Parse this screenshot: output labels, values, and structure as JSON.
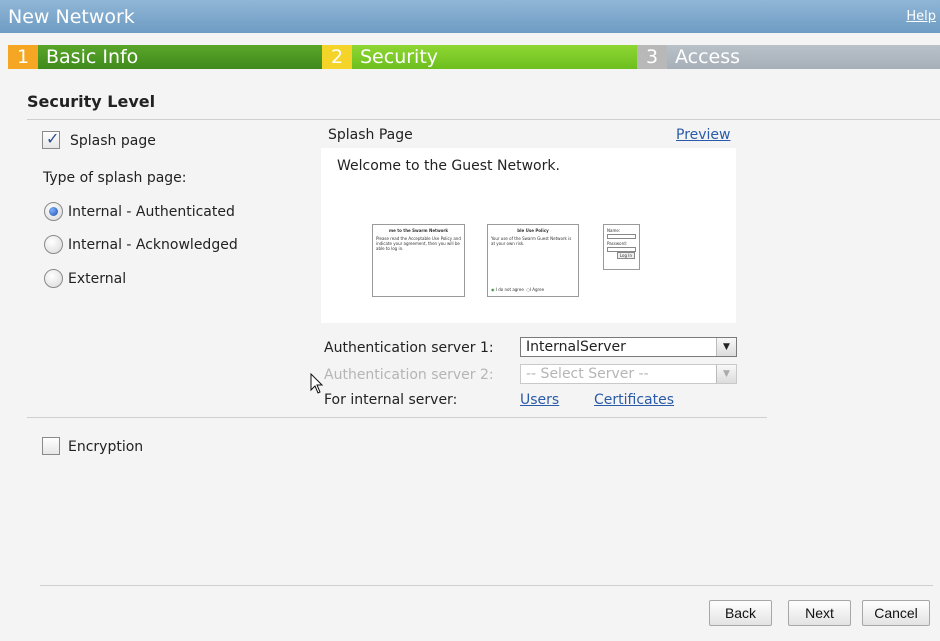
{
  "window": {
    "title": "New Network",
    "help_label": "Help"
  },
  "steps": [
    {
      "num": "1",
      "label": "Basic Info"
    },
    {
      "num": "2",
      "label": "Security"
    },
    {
      "num": "3",
      "label": "Access"
    }
  ],
  "section_title": "Security Level",
  "splash": {
    "checkbox_label": "Splash page",
    "checked": true,
    "type_label": "Type of splash page:",
    "options": [
      {
        "label": "Internal - Authenticated",
        "selected": true
      },
      {
        "label": "Internal - Acknowledged",
        "selected": false
      },
      {
        "label": "External",
        "selected": false
      }
    ]
  },
  "preview": {
    "header": "Splash Page",
    "link": "Preview",
    "welcome": "Welcome to the Guest Network.",
    "thumb1": {
      "title": "me to the Swarm Network",
      "body": "Please read the Acceptable Use Policy and indicate your agreement, then you will be able to log in."
    },
    "thumb2": {
      "title": "ble Use Policy",
      "body": "Your use of the Swarm Guest Network is at your own risk.",
      "opt_disagree": "I do not agree",
      "opt_agree": "I Agree"
    },
    "thumb3": {
      "name_label": "Name:",
      "password_label": "Password:",
      "button": "Log In"
    }
  },
  "auth": {
    "server1_label": "Authentication server 1:",
    "server1_value": "InternalServer",
    "server2_label": "Authentication server 2:",
    "server2_value": "-- Select Server --",
    "internal_label": "For internal server:",
    "users_link": "Users",
    "certificates_link": "Certificates"
  },
  "encryption": {
    "label": "Encryption",
    "checked": false
  },
  "buttons": {
    "back": "Back",
    "next": "Next",
    "cancel": "Cancel"
  },
  "colors": {
    "title_bar": "#7ba6cc",
    "step1": "#4c9a23",
    "step2": "#7ccc24",
    "step3": "#aeb6be",
    "link": "#2a5ba8"
  }
}
